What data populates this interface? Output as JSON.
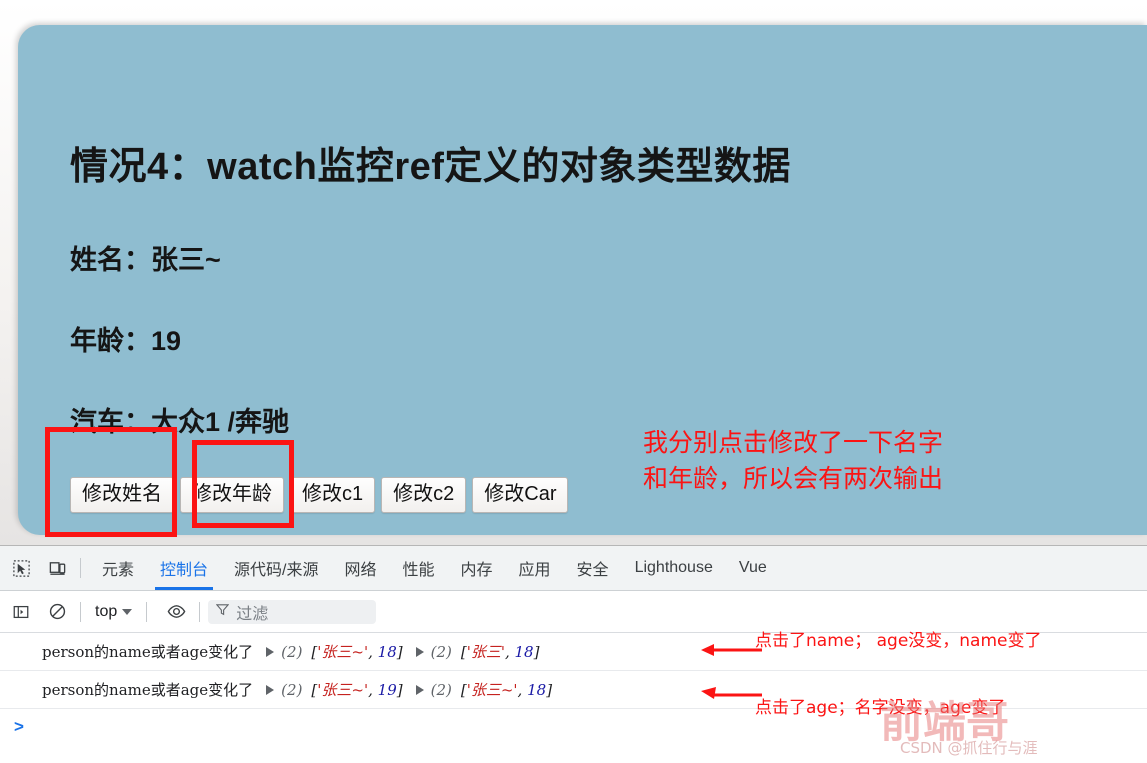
{
  "page": {
    "title": "情况4：watch监控ref定义的对象类型数据",
    "fields": [
      {
        "label": "姓名：",
        "value": "张三~"
      },
      {
        "label": "年龄：",
        "value": "19"
      },
      {
        "label": "汽车：",
        "value": "大众1 /奔驰"
      }
    ],
    "buttons": [
      {
        "label": "修改姓名"
      },
      {
        "label": "修改年龄"
      },
      {
        "label": "修改c1"
      },
      {
        "label": "修改c2"
      },
      {
        "label": "修改Car"
      }
    ],
    "note_line1": "我分别点击修改了一下名字",
    "note_line2": "和年龄，所以会有两次输出",
    "highlight_color": "#fb1414",
    "panel_color": "#8fbdd0"
  },
  "devtools": {
    "icons": {
      "inspect": "inspect-element-icon",
      "device": "device-toolbar-icon",
      "sidebar": "console-sidebar-icon",
      "clear": "clear-console-icon",
      "eye": "live-expression-eye-icon",
      "filter": "filter-funnel-icon"
    },
    "tabs": [
      {
        "label": "元素",
        "active": false
      },
      {
        "label": "控制台",
        "active": true
      },
      {
        "label": "源代码/来源",
        "active": false
      },
      {
        "label": "网络",
        "active": false
      },
      {
        "label": "性能",
        "active": false
      },
      {
        "label": "内存",
        "active": false
      },
      {
        "label": "应用",
        "active": false
      },
      {
        "label": "安全",
        "active": false
      },
      {
        "label": "Lighthouse",
        "active": false
      },
      {
        "label": "Vue",
        "active": false
      }
    ],
    "console_toolbar": {
      "context": "top",
      "filter_placeholder": "过滤"
    },
    "logs": [
      {
        "message": "person的name或者age变化了",
        "new_count": "(2)",
        "new_value": "['张三~', 18]",
        "new_str": "'张三~'",
        "new_num": "18",
        "old_count": "(2)",
        "old_value": "['张三', 18]",
        "old_str": "'张三'",
        "old_num": "18"
      },
      {
        "message": "person的name或者age变化了",
        "new_count": "(2)",
        "new_value": "['张三~', 19]",
        "new_str": "'张三~'",
        "new_num": "19",
        "old_count": "(2)",
        "old_value": "['张三~', 18]",
        "old_str": "'张三~'",
        "old_num": "18"
      }
    ],
    "prompt": ">",
    "annotations": [
      "点击了name； age没变，name变了",
      "点击了age；名字没变，age变了"
    ]
  },
  "watermark": {
    "big": "前端哥",
    "small": "CSDN @抓住行与涯"
  }
}
